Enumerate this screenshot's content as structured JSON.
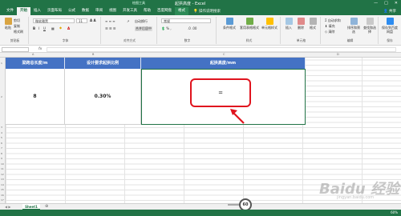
{
  "app": {
    "title": "起拱高度 - Excel",
    "context_tab": "绘图工具"
  },
  "tabs": [
    "文件",
    "开始",
    "插入",
    "页面布局",
    "公式",
    "数据",
    "审阅",
    "视图",
    "开发工具",
    "帮助",
    "百度网盘",
    "格式"
  ],
  "active_tab": "开始",
  "tell_me": "操作说明搜索",
  "share": "共享",
  "window_controls": [
    "—",
    "□",
    "✕"
  ],
  "ribbon": {
    "clipboard": {
      "paste": "粘贴",
      "cut": "剪切",
      "copy": "复制",
      "format_painter": "格式刷",
      "label": "剪贴板"
    },
    "font": {
      "name": "微软雅黑",
      "size": "11",
      "label": "字体"
    },
    "alignment": {
      "wrap": "自动换行",
      "merge": "合并后居中",
      "label": "对齐方式"
    },
    "number": {
      "format": "常规",
      "label": "数字"
    },
    "styles": {
      "conditional": "条件格式",
      "table": "套用表格格式",
      "cell": "单元格样式",
      "label": "样式"
    },
    "cells": {
      "insert": "插入",
      "delete": "删除",
      "format": "格式",
      "label": "单元格"
    },
    "editing": {
      "autosum": "自动求和",
      "fill": "填充",
      "clear": "清除",
      "sort": "排序和筛选",
      "find": "查找和选择",
      "label": "编辑"
    },
    "baidu": {
      "save": "保存到百度网盘",
      "label": "保存"
    }
  },
  "name_box": "",
  "columns": [
    "A",
    "B",
    "C",
    "D"
  ],
  "rows": [
    "1",
    "2",
    "3",
    "4",
    "5",
    "6",
    "7",
    "8",
    "9",
    "10",
    "11",
    "12",
    "13",
    "14",
    "15",
    "16",
    "17",
    "18",
    "19",
    "20",
    "21",
    "22",
    "23",
    "24",
    "25",
    "26"
  ],
  "table": {
    "headers": [
      "梁跨总长度/m",
      "设计要求起拱比例",
      "起拱高度/mm"
    ],
    "values": [
      "8",
      "0.30%",
      "="
    ]
  },
  "sheet_tab": "Sheet1",
  "zoom": "60",
  "watermark": "Baidu 经验",
  "watermark_sub": "jingyan.baidu.com",
  "colors": {
    "excel_green": "#217346",
    "header_blue": "#4472c4",
    "callout_red": "#e0141e"
  }
}
